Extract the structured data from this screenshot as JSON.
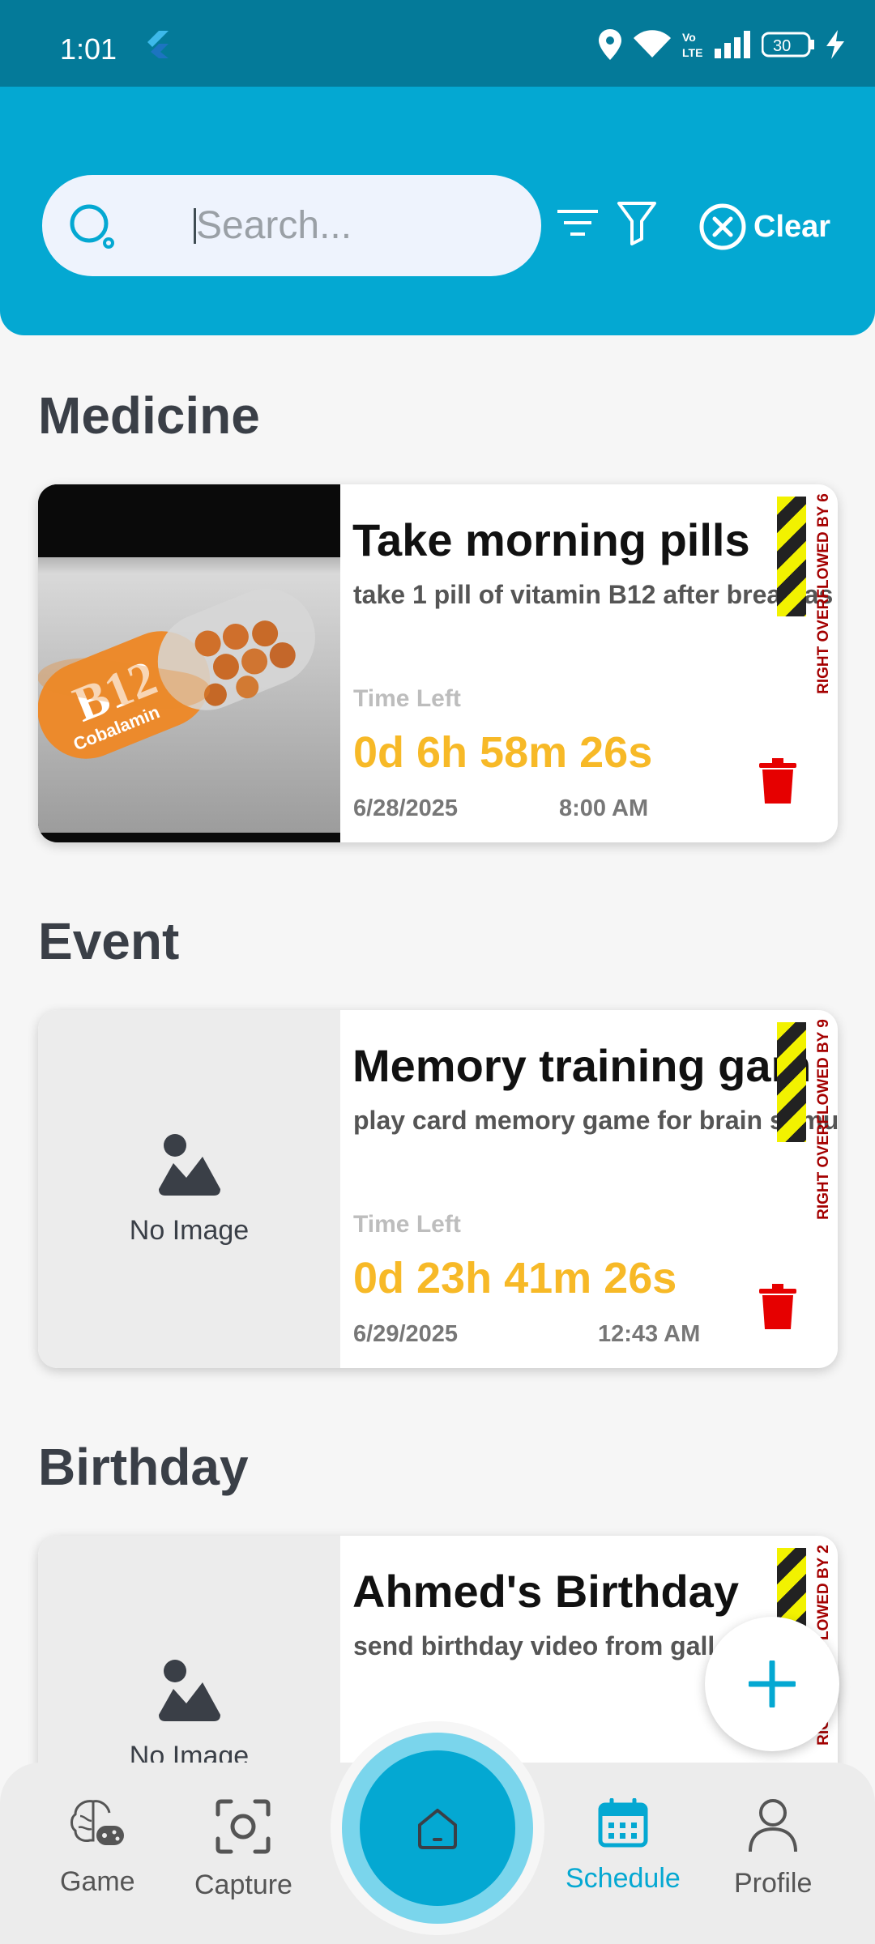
{
  "status_bar": {
    "time": "1:01",
    "battery": "30"
  },
  "search": {
    "placeholder": "Search..."
  },
  "header": {
    "clear_label": "Clear"
  },
  "sections": [
    {
      "title": "Medicine",
      "card": {
        "title": "Take morning pills",
        "description": "take 1 pill of vitamin B12 after breakfas",
        "time_left_label": "Time Left",
        "countdown": "0d 6h 58m 26s",
        "date": "6/28/2025",
        "time": "8:00 AM",
        "overflow_warning": "RIGHT OVERFLOWED BY 6",
        "image_text": "B12",
        "image_subtext": "Cobalamin"
      }
    },
    {
      "title": "Event",
      "card": {
        "title": "Memory training gam",
        "description": "play card memory game for brain stimu",
        "no_image_label": "No Image",
        "time_left_label": "Time Left",
        "countdown": "0d 23h 41m 26s",
        "date": "6/29/2025",
        "time": "12:43 AM",
        "overflow_warning": "RIGHT OVERFLOWED BY 9"
      }
    },
    {
      "title": "Birthday",
      "card": {
        "title": "Ahmed's Birthday",
        "description": "send birthday video from gall",
        "no_image_label": "No Image",
        "overflow_warning": "RIGHT OVERFLOWED BY 2"
      }
    }
  ],
  "bottom_nav": {
    "items": [
      {
        "label": "Game",
        "icon": "brain-gamepad-icon"
      },
      {
        "label": "Capture",
        "icon": "camera-capture-icon"
      },
      {
        "label": "Schedule",
        "icon": "calendar-icon",
        "active": true
      },
      {
        "label": "Profile",
        "icon": "person-icon"
      }
    ]
  },
  "colors": {
    "primary": "#04a8d2",
    "status_bar": "#047a99",
    "countdown": "#f7b927",
    "delete": "#e60000"
  }
}
